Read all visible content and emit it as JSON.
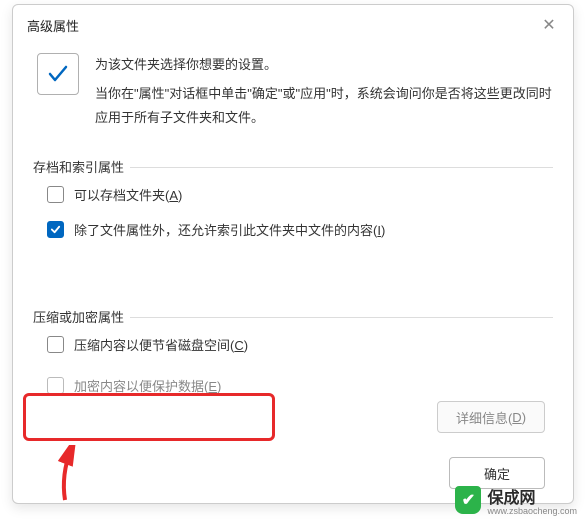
{
  "title": "高级属性",
  "header": {
    "line1": "为该文件夹选择你想要的设置。",
    "line2": "当你在\"属性\"对话框中单击\"确定\"或\"应用\"时，系统会询问你是否将这些更改同时应用于所有子文件夹和文件。"
  },
  "groups": {
    "archive": {
      "label": "存档和索引属性",
      "opt1": {
        "text": "可以存档文件夹(",
        "hotkey": "A",
        "suffix": ")",
        "checked": false
      },
      "opt2": {
        "text": "除了文件属性外，还允许索引此文件夹中文件的内容(",
        "hotkey": "I",
        "suffix": ")",
        "checked": true
      }
    },
    "compress": {
      "label": "压缩或加密属性",
      "opt1": {
        "text": "压缩内容以便节省磁盘空间(",
        "hotkey": "C",
        "suffix": ")",
        "checked": false
      },
      "opt2": {
        "text": "加密内容以便保护数据(",
        "hotkey": "E",
        "suffix": ")",
        "checked": false,
        "disabled": true
      }
    }
  },
  "buttons": {
    "details": {
      "text": "详细信息(",
      "hotkey": "D",
      "suffix": ")"
    },
    "ok": "确定"
  },
  "watermark": {
    "brand": "保成网",
    "url": "www.zsbaocheng.com"
  }
}
